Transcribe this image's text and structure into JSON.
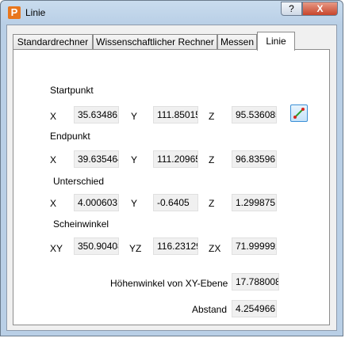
{
  "window": {
    "title": "Linie",
    "help_label": "?",
    "close_label": "X"
  },
  "tabs": [
    "Standardrechner",
    "Wissenschaftlicher Rechner",
    "Messen",
    "Linie"
  ],
  "sections": {
    "start": "Startpunkt",
    "end": "Endpunkt",
    "diff": "Unterschied",
    "angle": "Scheinwinkel"
  },
  "axes": {
    "x": "X",
    "y": "Y",
    "z": "Z",
    "xy": "XY",
    "yz": "YZ",
    "zx": "ZX"
  },
  "values": {
    "start": {
      "x": "35.634861",
      "y": "111.85015",
      "z": "95.536085"
    },
    "end": {
      "x": "39.635464",
      "y": "111.20965",
      "z": "96.83596"
    },
    "diff": {
      "x": "4.000603",
      "y": "-0.6405",
      "z": "1.299875"
    },
    "angle": {
      "xy": "350.90408",
      "yz": "116.23129",
      "zx": "71.999992"
    }
  },
  "elevation": {
    "label": "Höhenwinkel von XY-Ebene",
    "value": "17.788008"
  },
  "distance": {
    "label": "Abstand",
    "value": "4.254966"
  },
  "colors": {
    "accent": "#3b8fd6",
    "close": "#c8452c",
    "icon": "#e8761c"
  },
  "icons": {
    "app": "app-logo-icon",
    "pick": "line-pick-icon"
  }
}
